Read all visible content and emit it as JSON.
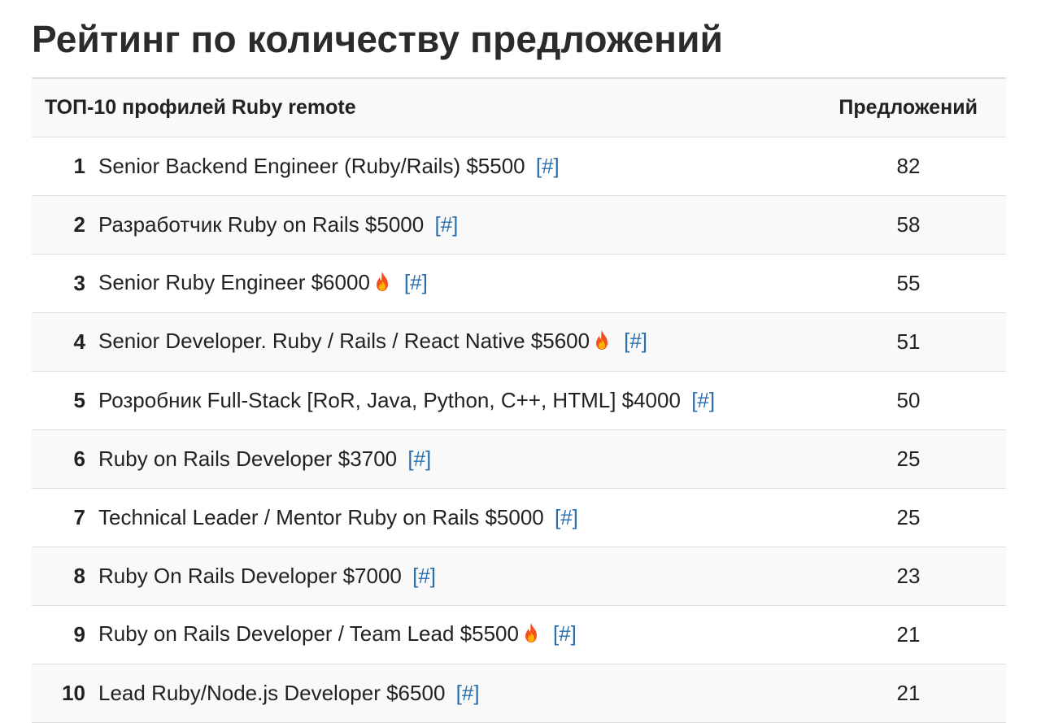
{
  "title": "Рейтинг по количеству предложений",
  "table": {
    "header_title": "ТОП-10 профилей Ruby remote",
    "header_count": "Предложений",
    "link_label": "[#]",
    "rows": [
      {
        "rank": "1",
        "title": "Senior Backend Engineer (Ruby/Rails) $5500",
        "hot": false,
        "count": "82"
      },
      {
        "rank": "2",
        "title": "Разработчик Ruby on Rails $5000",
        "hot": false,
        "count": "58"
      },
      {
        "rank": "3",
        "title": "Senior Ruby Engineer $6000",
        "hot": true,
        "count": "55"
      },
      {
        "rank": "4",
        "title": "Senior Developer. Ruby / Rails / React Native $5600",
        "hot": true,
        "count": "51"
      },
      {
        "rank": "5",
        "title": "Розробник Full-Stack [RoR, Java, Python, C++, HTML] $4000",
        "hot": false,
        "count": "50"
      },
      {
        "rank": "6",
        "title": "Ruby on Rails Developer $3700",
        "hot": false,
        "count": "25"
      },
      {
        "rank": "7",
        "title": "Technical Leader / Mentor Ruby on Rails $5000",
        "hot": false,
        "count": "25"
      },
      {
        "rank": "8",
        "title": "Ruby On Rails Developer $7000",
        "hot": false,
        "count": "23"
      },
      {
        "rank": "9",
        "title": "Ruby on Rails Developer / Team Lead $5500",
        "hot": true,
        "count": "21"
      },
      {
        "rank": "10",
        "title": "Lead Ruby/Node.js Developer $6500",
        "hot": false,
        "count": "21"
      }
    ]
  },
  "icons": {
    "hot": "fire-icon"
  },
  "colors": {
    "link": "#2a6fad",
    "stripe": "#f9f9f9",
    "border": "#dddddd"
  }
}
